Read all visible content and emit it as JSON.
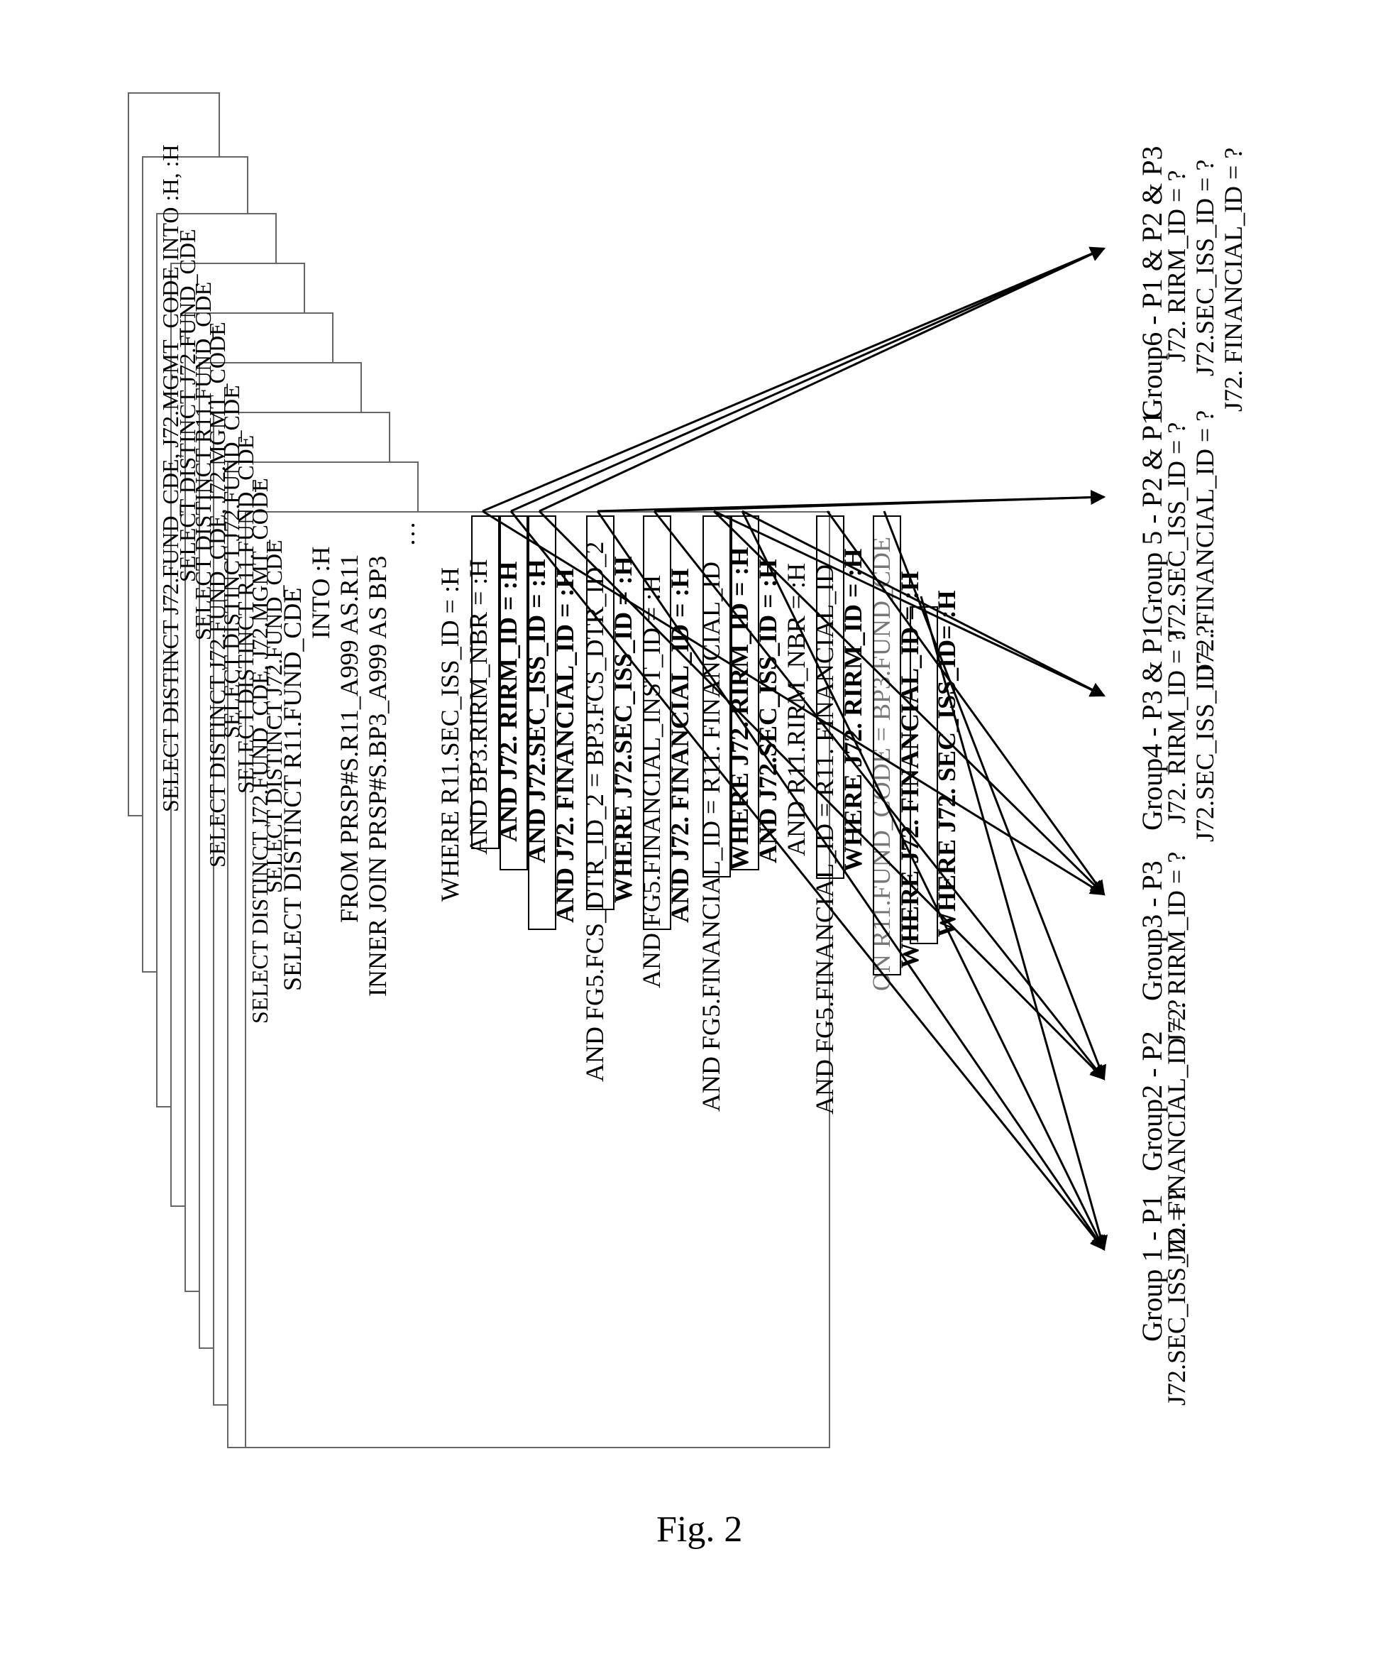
{
  "figure_label": "Fig. 2",
  "cards_headers": [
    "SELECT DISTINCT J72.FUND_CDE, J72.MGMT_CODE\nINTO :H, :H",
    "SELECT DISTINCT J72.FUND_CDE",
    "SELECT DISTINCT R11.FUND_CDE",
    "SELECT DISTINCT J72.FUND_CDE, J72.MGMT_CODE",
    "SELECT DISTINCT J72.FUND_CDE",
    "SELECT DISTINCT R11.FUND_CDE",
    "SELECT DISTINCT J72.FUND_CDE, J72.MGMT_CODE",
    "SELECT DISTINCT J72.FUND_CDE"
  ],
  "front_card": {
    "select1": "SELECT DISTINCT R11.FUND_CDE",
    "select2": "INTO :H",
    "from": "FROM PRSP#S.R11_A999 AS.R11",
    "join": "INNER JOIN PRSP#S.BP3_A999 AS BP3",
    "ellipsis": "…",
    "where1": "WHERE R11.SEC_ISS_ID = :H",
    "where2": "AND BP3.RIRM_NBR = :H",
    "p_rirm": "AND J72. RIRM_ID = :H",
    "p_sec": "AND J72.SEC_ISS_ID = :H",
    "p_fin": "AND J72. FINANCIAL_ID = :H",
    "tail1": "AND FG5.FCS_DTR_ID_2 = BP3.FCS_DTR_ID_2",
    "p_sec2": "WHERE J72.SEC_ISS_ID = :H",
    "tail2": "AND FG5.FINANCIAL_INST_ID = :H",
    "p_fin2": "AND J72. FINANCIAL_ID = :H",
    "tail3": "AND FG5.FINANCIAL_ID = R11. FINANCIAL_ID",
    "p_rirm2": "WHERE J72. RIRM_ID = :H",
    "p_sec3": "AND J72.SEC_ISS_ID = :H",
    "tail4": "AND R11.RIRM_NBR = :H",
    "tail5": "AND FG5.FINANCIAL_ID = R11. FINANCIAL_ID",
    "p_rirm3": "WHERE J72. RIRM_ID = :H",
    "tail6": "ON R11.FUND_CODE = BP3.FUND_CDE",
    "p_fin3": "WHERE J72. FINANCIAL_ID = :H",
    "p_sec4": "WHERE J72. SEC_ISS_ID= :H"
  },
  "groups": [
    {
      "title": "Group6 -  P1 & P2 & P3",
      "preds": [
        "J72. RIRM_ID = ?",
        "J72.SEC_ISS_ID = ?",
        "J72. FINANCIAL_ID = ?"
      ]
    },
    {
      "title": "Group 5 - P2 & P1",
      "preds": [
        "J72.SEC_ISS_ID = ?",
        "J72. FINANCIAL_ID = ?"
      ]
    },
    {
      "title": "Group4 - P3 & P1",
      "preds": [
        "J72. RIRM_ID = ?",
        "J72.SEC_ISS_ID = ?"
      ]
    },
    {
      "title": "Group3  - P3",
      "preds": [
        "J72. RIRM_ID = ?"
      ]
    },
    {
      "title": "Group2 - P2",
      "preds": [
        "J72. FINANCIAL_ID = ?"
      ]
    },
    {
      "title": "Group 1 - P1",
      "preds": [
        "J72.SEC_ISS_ID = ?"
      ]
    }
  ]
}
